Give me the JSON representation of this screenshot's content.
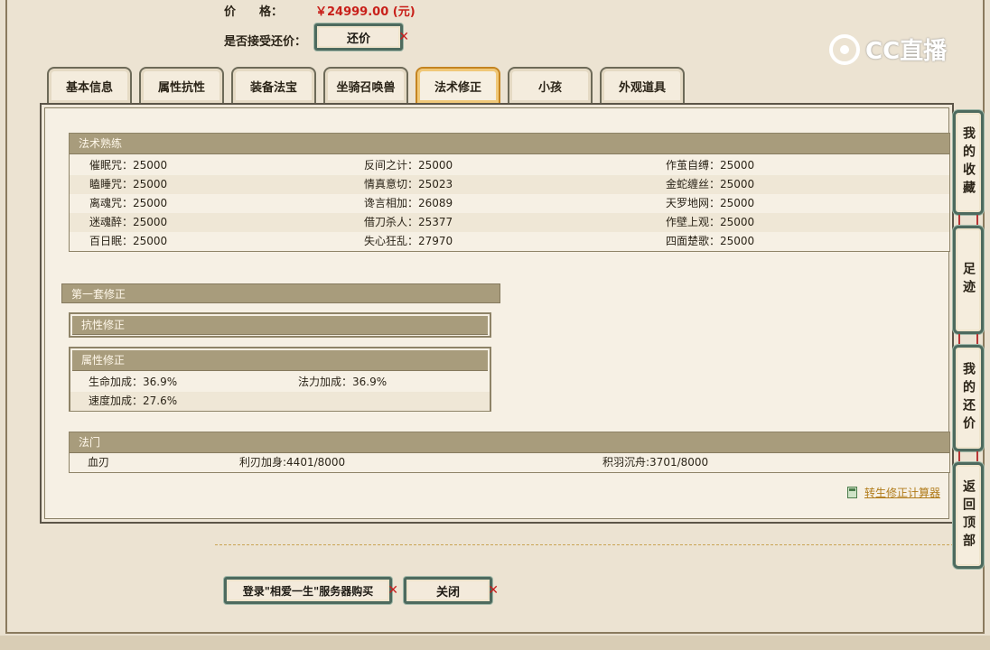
{
  "header": {
    "price_label": "价　　格：",
    "price_value": "￥24999.00 (元)",
    "accept_label": "是否接受还价：",
    "counter_offer_button": "还价"
  },
  "logo": {
    "text": "CC直播"
  },
  "tabs": [
    {
      "label": "基本信息"
    },
    {
      "label": "属性抗性"
    },
    {
      "label": "装备法宝"
    },
    {
      "label": "坐骑召唤兽"
    },
    {
      "label": "法术修正",
      "active": true
    },
    {
      "label": "小孩"
    },
    {
      "label": "外观道具"
    }
  ],
  "spell_mastery": {
    "title": "法术熟练",
    "rows": [
      [
        "催眠咒：25000",
        "反间之计：25000",
        "作茧自缚：25000"
      ],
      [
        "瞌睡咒：25000",
        "情真意切：25023",
        "金蛇缠丝：25000"
      ],
      [
        "离魂咒：25000",
        "谗言相加：26089",
        "天罗地网：25000"
      ],
      [
        "迷魂醉：25000",
        "借刀杀人：25377",
        "作壁上观：25000"
      ],
      [
        "百日眠：25000",
        "失心狂乱：27970",
        "四面楚歌：25000"
      ]
    ]
  },
  "modifier_set": {
    "title": "第一套修正",
    "resist_title": "抗性修正",
    "attr_title": "属性修正",
    "attr_rows": [
      [
        "生命加成：36.9%",
        "法力加成：36.9%"
      ],
      [
        "速度加成：27.6%",
        ""
      ]
    ]
  },
  "fa_men": {
    "title": "法门",
    "cells": [
      "血刃",
      "利刃加身:4401/8000",
      "积羽沉舟:3701/8000"
    ]
  },
  "calculator_link": "转生修正计算器",
  "footer": {
    "login_button": "登录\"相爱一生\"服务器购买",
    "close_button": "关闭"
  },
  "side_buttons": [
    {
      "label": "我的收藏"
    },
    {
      "label": "足迹"
    },
    {
      "label": "我的还价"
    },
    {
      "label": "返回顶部"
    }
  ]
}
